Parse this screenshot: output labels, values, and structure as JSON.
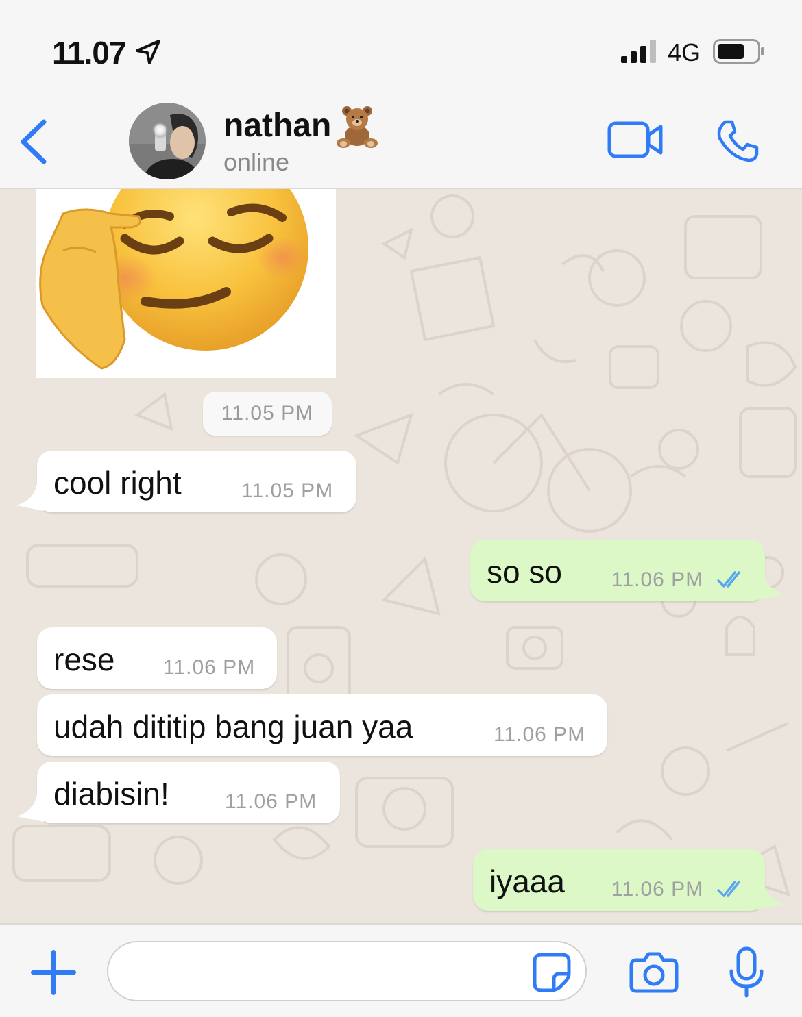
{
  "status_bar": {
    "time": "11.07",
    "network": "4G"
  },
  "header": {
    "contact_name": "nathan",
    "contact_status": "online"
  },
  "chat": {
    "date_pill": "11.05 PM",
    "messages": [
      {
        "direction": "in",
        "text": "cool right",
        "time": "11.05 PM"
      },
      {
        "direction": "out",
        "text": "so so",
        "time": "11.06 PM"
      },
      {
        "direction": "in",
        "text": "rese",
        "time": "11.06 PM"
      },
      {
        "direction": "in",
        "text": "udah dititip bang juan yaa",
        "time": "11.06 PM"
      },
      {
        "direction": "in",
        "text": "diabisin!",
        "time": "11.06 PM"
      },
      {
        "direction": "out",
        "text": "iyaaa",
        "time": "11.06 PM"
      }
    ]
  },
  "colors": {
    "accent": "#2f7cf6",
    "incoming_bubble": "#ffffff",
    "outgoing_bubble": "#dcf8c6",
    "chat_background": "#ece5dd",
    "read_ticks": "#5aa7f0"
  }
}
